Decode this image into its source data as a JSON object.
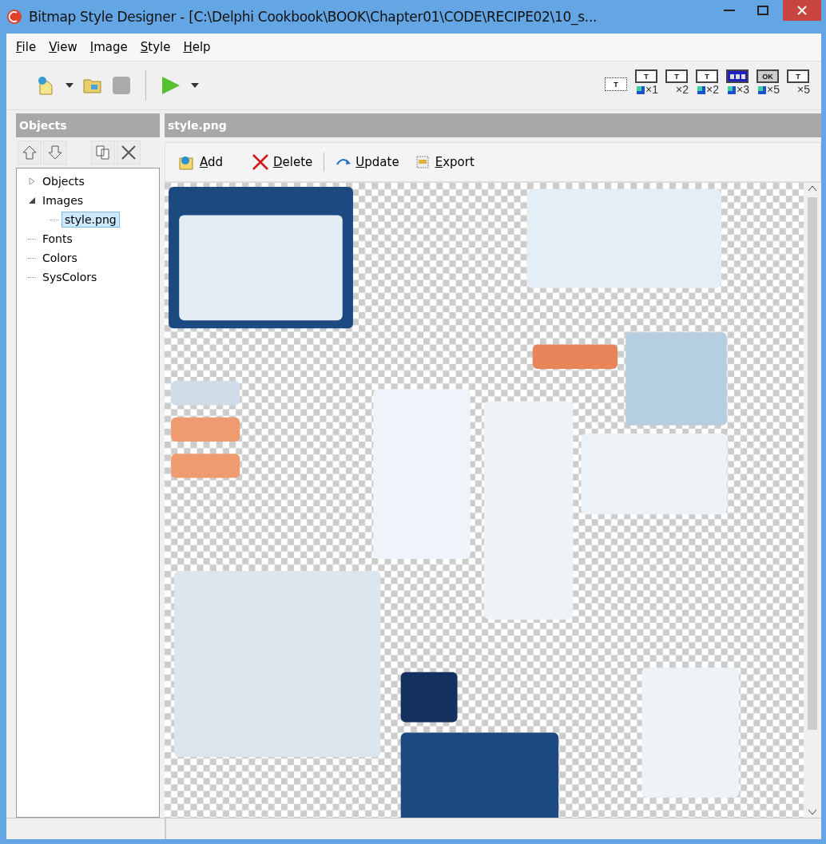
{
  "window": {
    "title": "Bitmap Style Designer - [C:\\Delphi Cookbook\\BOOK\\Chapter01\\CODE\\RECIPE02\\10_s...",
    "controls": [
      {
        "kind": "minimize"
      },
      {
        "kind": "maximize"
      },
      {
        "kind": "close"
      }
    ]
  },
  "menu": [
    "File",
    "View",
    "Image",
    "Style",
    "Help"
  ],
  "toolbar": {
    "left": [
      {
        "kind": "new"
      },
      {
        "kind": "caret"
      },
      {
        "kind": "open"
      },
      {
        "kind": "stop"
      },
      {
        "kind": "separator"
      },
      {
        "kind": "run"
      },
      {
        "kind": "caret"
      }
    ],
    "previews": [
      {
        "kind": "dotted",
        "glyph": "T"
      },
      {
        "kind": "frame",
        "glyph": "T",
        "label": "×1",
        "swatch": true
      },
      {
        "kind": "frame",
        "glyph": "T",
        "label": "×2",
        "swatch": false
      },
      {
        "kind": "frame",
        "glyph": "T",
        "label": "×2",
        "swatch": true
      },
      {
        "kind": "caption",
        "label": "×3",
        "swatch": true
      },
      {
        "kind": "ok",
        "glyph": "OK",
        "label": "×5",
        "swatch": true
      },
      {
        "kind": "frame",
        "glyph": "T",
        "label": "×5",
        "swatch": false
      }
    ]
  },
  "objects_panel": {
    "title": "Objects",
    "tools": [
      {
        "kind": "up"
      },
      {
        "kind": "down"
      },
      {
        "kind": "copy"
      },
      {
        "kind": "delete"
      }
    ],
    "tree": [
      {
        "label": "Objects",
        "expanded": false,
        "selected": false
      },
      {
        "label": "Images",
        "expanded": true,
        "selected": false,
        "children": [
          {
            "label": "style.png",
            "selected": true
          }
        ]
      },
      {
        "label": "Fonts",
        "selected": false
      },
      {
        "label": "Colors",
        "selected": false
      },
      {
        "label": "SysColors",
        "selected": false
      }
    ]
  },
  "image_panel": {
    "title": "style.png",
    "actions": [
      {
        "kind": "add",
        "label": "Add"
      },
      {
        "kind": "delete",
        "label": "Delete"
      },
      {
        "kind": "separator"
      },
      {
        "kind": "update",
        "label": "Update"
      },
      {
        "kind": "export",
        "label": "Export"
      }
    ]
  }
}
